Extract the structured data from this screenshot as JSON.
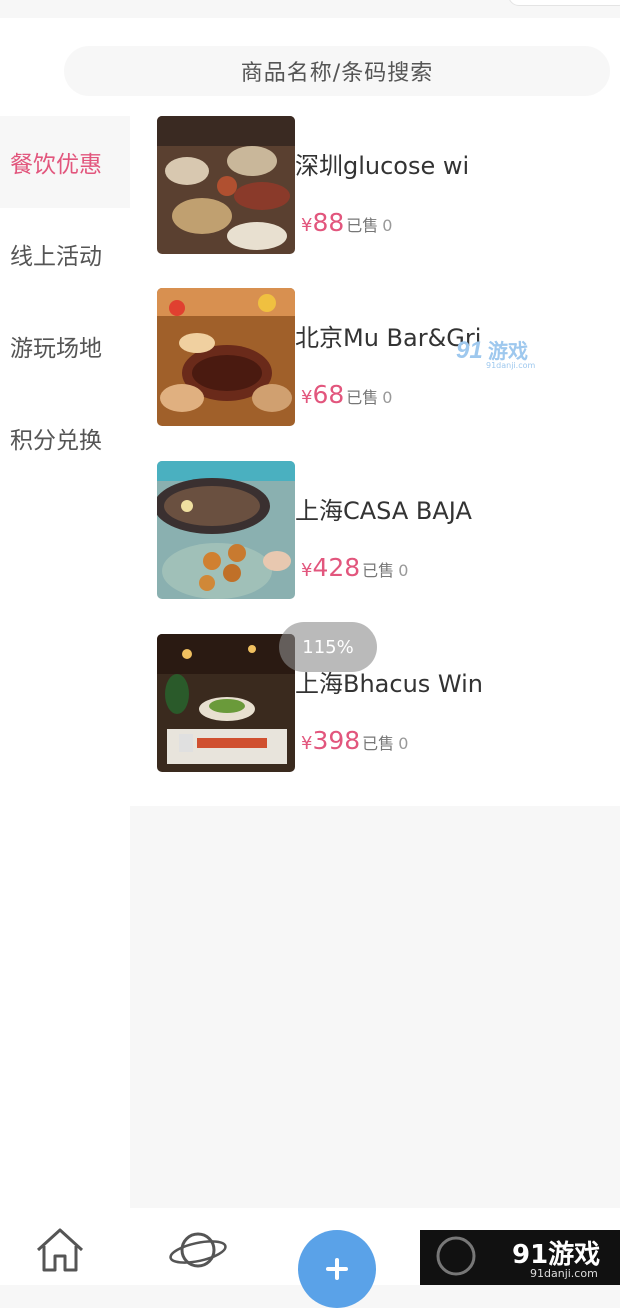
{
  "search": {
    "placeholder": "商品名称/条码搜索"
  },
  "sidebar": {
    "items": [
      {
        "label": "餐饮优惠",
        "active": true
      },
      {
        "label": "线上活动"
      },
      {
        "label": "游玩场地"
      },
      {
        "label": "积分兑换"
      }
    ]
  },
  "products": [
    {
      "title": "深圳glucose wi",
      "currency": "¥",
      "price": "88",
      "sold_label": "已售",
      "sold": "0"
    },
    {
      "title": "北京Mu Bar&Gri",
      "currency": "¥",
      "price": "68",
      "sold_label": "已售",
      "sold": "0"
    },
    {
      "title": "上海CASA BAJA",
      "currency": "¥",
      "price": "428",
      "sold_label": "已售",
      "sold": "0"
    },
    {
      "title": "上海Bhacus Win",
      "currency": "¥",
      "price": "398",
      "sold_label": "已售",
      "sold": "0"
    }
  ],
  "zoom_indicator": "115%",
  "watermark": {
    "brand": "91游戏",
    "site": "91danji.com"
  },
  "tabbar": {
    "icons": [
      "home-icon",
      "planet-icon",
      "add-icon",
      "user-icon"
    ]
  },
  "colors": {
    "accent": "#e2567d",
    "fab": "#5aa2e8",
    "background": "#f7f7f7"
  }
}
